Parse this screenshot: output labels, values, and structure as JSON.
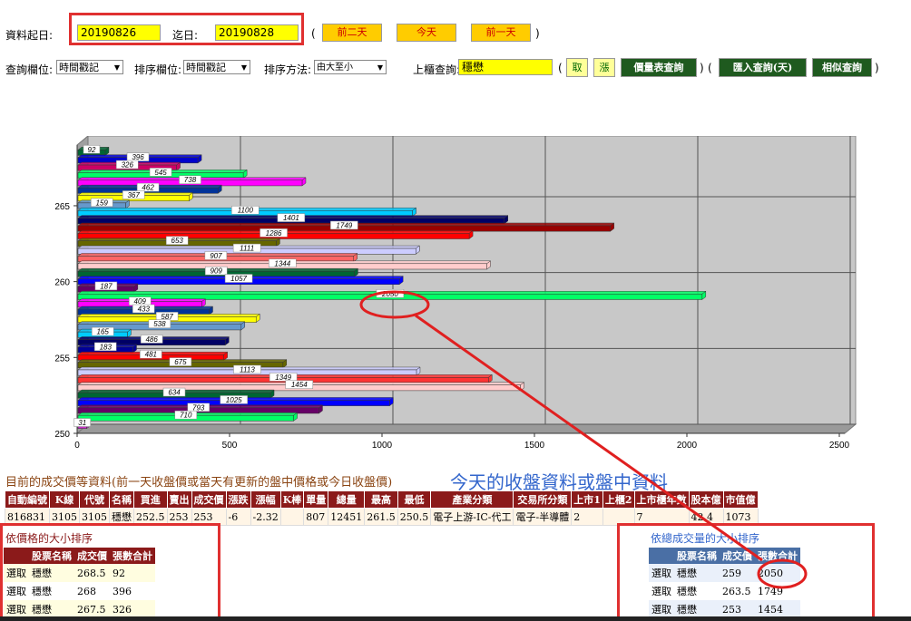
{
  "form": {
    "start_label": "資料起日:",
    "start_value": "20190826",
    "end_label": "迄日:",
    "end_value": "20190828",
    "paren_open": "(",
    "paren_close": ")",
    "btn_two_days": "前二天",
    "btn_today": "今天",
    "btn_prev_day": "前一天",
    "query_field_label": "查詢欄位:",
    "query_field_value": "時間戳記",
    "sort_field_label": "排序欄位:",
    "sort_field_value": "時間戳記",
    "sort_method_label": "排序方法:",
    "sort_method_value": "由大至小",
    "listing_label": "上櫃查詢:",
    "listing_value": "穩懋",
    "btn_take": "取",
    "btn_rise": "漲",
    "btn_price_volume": "價量表查詢",
    "btn_import": "匯入查詢(天)",
    "btn_similar": "相似查詢"
  },
  "chart_data": {
    "type": "bar",
    "orientation": "horizontal",
    "xlim": [
      0,
      2500
    ],
    "xticks": [
      "0",
      "500",
      "1000",
      "1500",
      "2000",
      "2500"
    ],
    "ylim": [
      250,
      269
    ],
    "yticks": [
      "250",
      "255",
      "260",
      "265"
    ],
    "grid": true,
    "bars": [
      {
        "y": 250.5,
        "value": 31,
        "color": "#cc33cc"
      },
      {
        "y": 251,
        "value": 710,
        "color": "#00ff66"
      },
      {
        "y": 251.5,
        "value": 793,
        "color": "#660066"
      },
      {
        "y": 252,
        "value": 1025,
        "color": "#0000ff"
      },
      {
        "y": 252.5,
        "value": 634,
        "color": "#006633"
      },
      {
        "y": 253,
        "value": 1454,
        "color": "#ffcccc"
      },
      {
        "y": 253.5,
        "value": 1349,
        "color": "#ff3333"
      },
      {
        "y": 254,
        "value": 1113,
        "color": "#ccccff"
      },
      {
        "y": 254.5,
        "value": 675,
        "color": "#666600"
      },
      {
        "y": 255,
        "value": 481,
        "color": "#ff0000"
      },
      {
        "y": 255.5,
        "value": 183,
        "color": "#000099"
      },
      {
        "y": 256,
        "value": 486,
        "color": "#000066"
      },
      {
        "y": 256.5,
        "value": 165,
        "color": "#00ccff"
      },
      {
        "y": 257,
        "value": 538,
        "color": "#6699cc"
      },
      {
        "y": 257.5,
        "value": 587,
        "color": "#ffff00"
      },
      {
        "y": 258,
        "value": 433,
        "color": "#003399"
      },
      {
        "y": 258.5,
        "value": 409,
        "color": "#ff00ff"
      },
      {
        "y": 259,
        "value": 2050,
        "color": "#00ff66"
      },
      {
        "y": 259.5,
        "value": 187,
        "color": "#660066"
      },
      {
        "y": 260,
        "value": 1057,
        "color": "#0000ff"
      },
      {
        "y": 260.5,
        "value": 909,
        "color": "#006633"
      },
      {
        "y": 261,
        "value": 1344,
        "color": "#ffcccc"
      },
      {
        "y": 261.5,
        "value": 907,
        "color": "#ff6666"
      },
      {
        "y": 262,
        "value": 1111,
        "color": "#ccccff"
      },
      {
        "y": 262.5,
        "value": 653,
        "color": "#666600"
      },
      {
        "y": 263,
        "value": 1286,
        "color": "#ff0000"
      },
      {
        "y": 263.5,
        "value": 1749,
        "color": "#990000"
      },
      {
        "y": 264,
        "value": 1401,
        "color": "#000066"
      },
      {
        "y": 264.5,
        "value": 1100,
        "color": "#00ccff"
      },
      {
        "y": 265,
        "value": 159,
        "color": "#6699cc"
      },
      {
        "y": 265.5,
        "value": 367,
        "color": "#ffff00"
      },
      {
        "y": 266,
        "value": 462,
        "color": "#003399"
      },
      {
        "y": 266.5,
        "value": 738,
        "color": "#ff00ff"
      },
      {
        "y": 267,
        "value": 545,
        "color": "#00ff66"
      },
      {
        "y": 267.5,
        "value": 326,
        "color": "#cc0066"
      },
      {
        "y": 268,
        "value": 396,
        "color": "#0000cc"
      },
      {
        "y": 268.5,
        "value": 92,
        "color": "#006633"
      }
    ]
  },
  "section": {
    "quote_title": "目前的成交價等資料(前一天收盤價或當天有更新的盤中價格或今日收盤價)",
    "annotation": "今天的收盤資料或盤中資料"
  },
  "quote_table": {
    "headers": [
      "自動編號",
      "K線",
      "代號",
      "名稱",
      "買進",
      "賣出",
      "成交價",
      "漲跌",
      "漲幅",
      "K棒",
      "單量",
      "總量",
      "最高",
      "最低",
      "產業分類",
      "交易所分類",
      "上市1",
      "上櫃2",
      "上市櫃年數",
      "股本億",
      "市值億"
    ],
    "row": [
      "816831",
      "3105",
      "3105",
      "穩懋",
      "252.5",
      "253",
      "253",
      "-6",
      "-2.32",
      "",
      "807",
      "12451",
      "261.5",
      "250.5",
      "電子上游-IC-代工",
      "電子-半導體",
      "2",
      "",
      "7",
      "42.4",
      "1073"
    ]
  },
  "price_sort": {
    "title": "依價格的大小排序",
    "headers": [
      "",
      "股票名稱",
      "成交價",
      "張數合計"
    ],
    "rows": [
      [
        "選取",
        "穩懋",
        "268.5",
        "92"
      ],
      [
        "選取",
        "穩懋",
        "268",
        "396"
      ],
      [
        "選取",
        "穩懋",
        "267.5",
        "326"
      ]
    ]
  },
  "volume_sort": {
    "title": "依總成交量的大小排序",
    "headers": [
      "",
      "股票名稱",
      "成交價",
      "張數合計"
    ],
    "rows": [
      [
        "選取",
        "穩懋",
        "259",
        "2050"
      ],
      [
        "選取",
        "穩懋",
        "263.5",
        "1749"
      ],
      [
        "選取",
        "穩懋",
        "253",
        "1454"
      ]
    ]
  }
}
